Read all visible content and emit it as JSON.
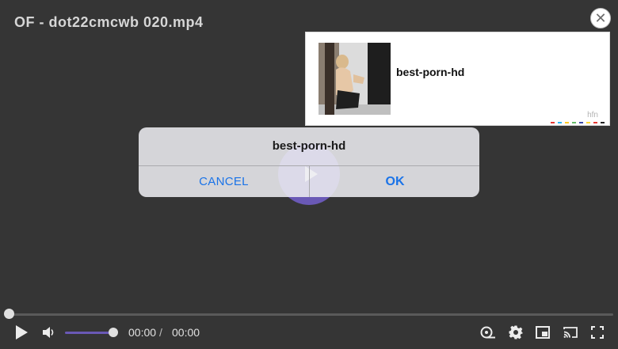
{
  "video": {
    "title": "OF - dot22cmcwb 020.mp4"
  },
  "ad": {
    "title": "best-porn-hd",
    "brand": "hfn",
    "close_symbol": "✕",
    "dot_colors": [
      "#e53935",
      "#29b6f6",
      "#ffca28",
      "#66bb6a",
      "#3949ab",
      "#fdd835",
      "#e53935",
      "#212121"
    ]
  },
  "dialog": {
    "message": "best-porn-hd",
    "cancel_label": "CANCEL",
    "ok_label": "OK"
  },
  "player": {
    "current_time": "00:00",
    "separator": "/",
    "total_time": "00:00",
    "progress": 0,
    "volume": 1.0,
    "accent_color": "#6a59b6",
    "icons": [
      "play-icon",
      "volume-icon",
      "speed-icon",
      "settings-icon",
      "picture-in-picture-icon",
      "cast-icon",
      "fullscreen-icon"
    ]
  }
}
